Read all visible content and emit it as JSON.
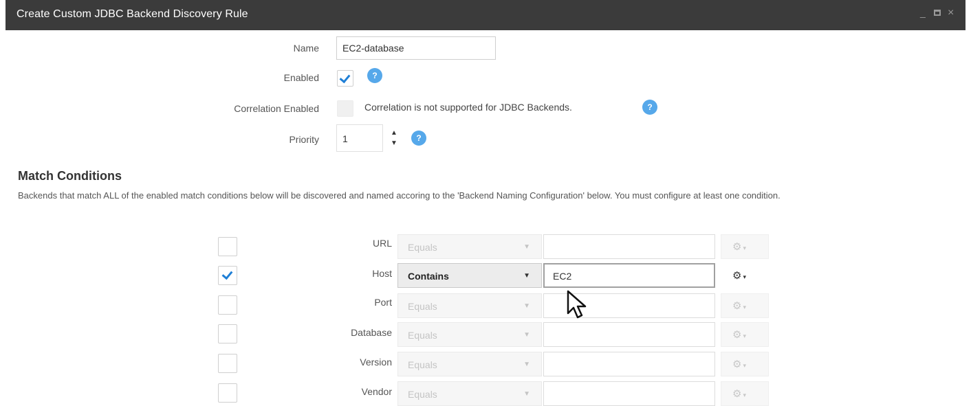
{
  "window": {
    "title": "Create Custom JDBC Backend Discovery Rule",
    "controls": {
      "minimize": "_",
      "close": "×"
    }
  },
  "form": {
    "name_label": "Name",
    "name_value": "EC2-database",
    "enabled_label": "Enabled",
    "enabled_checked": true,
    "correlation_label": "Correlation Enabled",
    "correlation_note": "Correlation is not supported for JDBC Backends.",
    "priority_label": "Priority",
    "priority_value": "1",
    "help_glyph": "?"
  },
  "match": {
    "title": "Match Conditions",
    "description": "Backends that match ALL of the enabled match conditions below will be discovered and named accoring to the 'Backend Naming Configuration' below.  You must configure at least one condition.",
    "rows": [
      {
        "label": "URL",
        "checked": false,
        "operator": "Equals",
        "value": ""
      },
      {
        "label": "Host",
        "checked": true,
        "operator": "Contains",
        "value": "EC2"
      },
      {
        "label": "Port",
        "checked": false,
        "operator": "Equals",
        "value": ""
      },
      {
        "label": "Database",
        "checked": false,
        "operator": "Equals",
        "value": ""
      },
      {
        "label": "Version",
        "checked": false,
        "operator": "Equals",
        "value": ""
      },
      {
        "label": "Vendor",
        "checked": false,
        "operator": "Equals",
        "value": ""
      }
    ],
    "gear_icon": "gear-icon",
    "caret_glyph": "▼"
  },
  "colors": {
    "titlebar": "#3b3b3b",
    "accent": "#1f7fd6",
    "help": "#56a8ea"
  }
}
